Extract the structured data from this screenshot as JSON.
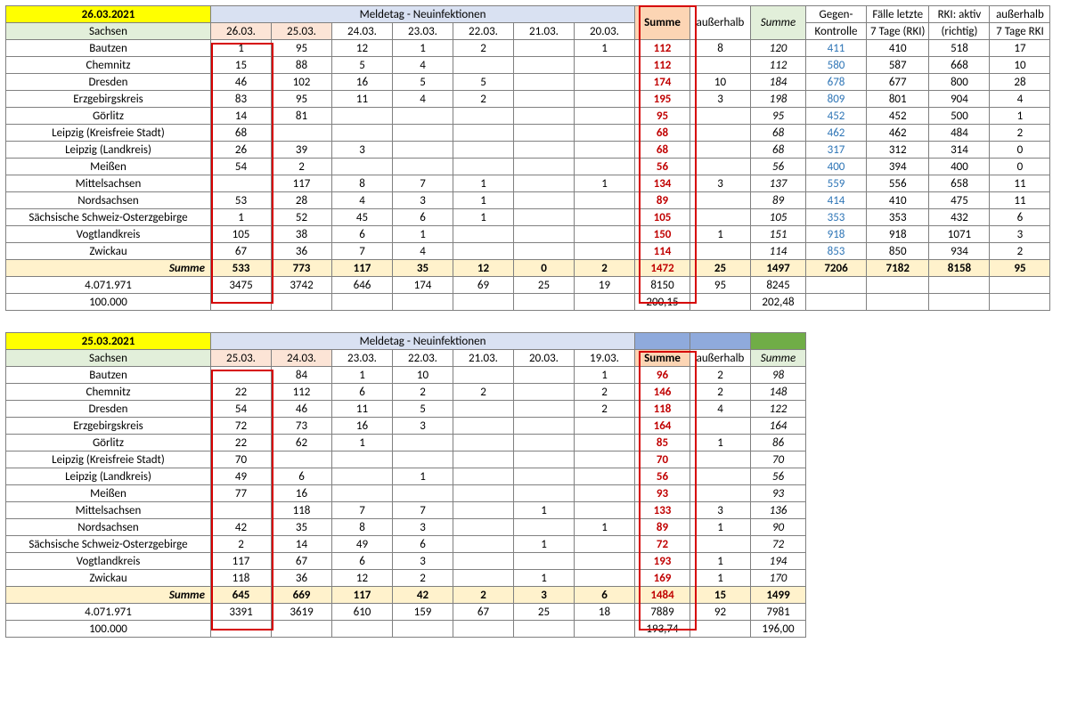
{
  "tables": [
    {
      "date": "26.03.2021",
      "title": "Meldetag - Neuinfektionen",
      "region_header": "Sachsen",
      "dates": [
        "26.03.",
        "25.03.",
        "24.03.",
        "23.03.",
        "22.03.",
        "21.03.",
        "20.03."
      ],
      "sum_label": "Summe",
      "ausserhalb_label": "außerhalb",
      "summe2_label": "Summe",
      "extra_headers1": [
        "Gegen-",
        "Fälle letzte",
        "RKI: aktiv",
        "außerhalb"
      ],
      "extra_headers2": [
        "Kontrolle",
        "7 Tage (RKI)",
        "(richtig)",
        "7 Tage RKI"
      ],
      "rows": [
        {
          "name": "Bautzen",
          "v": [
            "1",
            "95",
            "12",
            "1",
            "2",
            "",
            "1"
          ],
          "sum": "112",
          "aus": "8",
          "sum2": "120",
          "ext": [
            "411",
            "410",
            "518",
            "17"
          ]
        },
        {
          "name": "Chemnitz",
          "v": [
            "15",
            "88",
            "5",
            "4",
            "",
            "",
            ""
          ],
          "sum": "112",
          "aus": "",
          "sum2": "112",
          "ext": [
            "580",
            "587",
            "668",
            "10"
          ]
        },
        {
          "name": "Dresden",
          "v": [
            "46",
            "102",
            "16",
            "5",
            "5",
            "",
            ""
          ],
          "sum": "174",
          "aus": "10",
          "sum2": "184",
          "ext": [
            "678",
            "677",
            "800",
            "28"
          ]
        },
        {
          "name": "Erzgebirgskreis",
          "v": [
            "83",
            "95",
            "11",
            "4",
            "2",
            "",
            ""
          ],
          "sum": "195",
          "aus": "3",
          "sum2": "198",
          "ext": [
            "809",
            "801",
            "904",
            "4"
          ]
        },
        {
          "name": "Görlitz",
          "v": [
            "14",
            "81",
            "",
            "",
            "",
            "",
            ""
          ],
          "sum": "95",
          "aus": "",
          "sum2": "95",
          "ext": [
            "452",
            "452",
            "500",
            "1"
          ]
        },
        {
          "name": "Leipzig (Kreisfreie Stadt)",
          "v": [
            "68",
            "",
            "",
            "",
            "",
            "",
            ""
          ],
          "sum": "68",
          "aus": "",
          "sum2": "68",
          "ext": [
            "462",
            "462",
            "484",
            "2"
          ]
        },
        {
          "name": "Leipzig (Landkreis)",
          "v": [
            "26",
            "39",
            "3",
            "",
            "",
            "",
            ""
          ],
          "sum": "68",
          "aus": "",
          "sum2": "68",
          "ext": [
            "317",
            "312",
            "314",
            "0"
          ]
        },
        {
          "name": "Meißen",
          "v": [
            "54",
            "2",
            "",
            "",
            "",
            "",
            ""
          ],
          "sum": "56",
          "aus": "",
          "sum2": "56",
          "ext": [
            "400",
            "394",
            "400",
            "0"
          ]
        },
        {
          "name": "Mittelsachsen",
          "v": [
            "",
            "117",
            "8",
            "7",
            "1",
            "",
            "1"
          ],
          "sum": "134",
          "aus": "3",
          "sum2": "137",
          "ext": [
            "559",
            "556",
            "658",
            "11"
          ]
        },
        {
          "name": "Nordsachsen",
          "v": [
            "53",
            "28",
            "4",
            "3",
            "1",
            "",
            ""
          ],
          "sum": "89",
          "aus": "",
          "sum2": "89",
          "ext": [
            "414",
            "410",
            "475",
            "11"
          ]
        },
        {
          "name": "Sächsische Schweiz-Osterzgebirge",
          "v": [
            "1",
            "52",
            "45",
            "6",
            "1",
            "",
            ""
          ],
          "sum": "105",
          "aus": "",
          "sum2": "105",
          "ext": [
            "353",
            "353",
            "432",
            "6"
          ]
        },
        {
          "name": "Vogtlandkreis",
          "v": [
            "105",
            "38",
            "6",
            "1",
            "",
            "",
            ""
          ],
          "sum": "150",
          "aus": "1",
          "sum2": "151",
          "ext": [
            "918",
            "918",
            "1071",
            "3"
          ]
        },
        {
          "name": "Zwickau",
          "v": [
            "67",
            "36",
            "7",
            "4",
            "",
            "",
            ""
          ],
          "sum": "114",
          "aus": "",
          "sum2": "114",
          "ext": [
            "853",
            "850",
            "934",
            "2"
          ]
        }
      ],
      "totals": {
        "label": "Summe",
        "v": [
          "533",
          "773",
          "117",
          "35",
          "12",
          "0",
          "2"
        ],
        "sum": "1472",
        "aus": "25",
        "sum2": "1497",
        "ext": [
          "7206",
          "7182",
          "8158",
          "95"
        ]
      },
      "pop": {
        "label": "4.071.971",
        "v": [
          "3475",
          "3742",
          "646",
          "174",
          "69",
          "25",
          "19"
        ],
        "sum": "8150",
        "aus": "95",
        "sum2": "8245"
      },
      "per100k": {
        "label": "100.000",
        "v": [
          "",
          "",
          "",
          "",
          "",
          "",
          ""
        ],
        "sum": "200,15",
        "aus": "",
        "sum2": "202,48"
      }
    },
    {
      "date": "25.03.2021",
      "title": "Meldetag - Neuinfektionen",
      "region_header": "Sachsen",
      "dates": [
        "25.03.",
        "24.03.",
        "23.03.",
        "22.03.",
        "21.03.",
        "20.03.",
        "19.03."
      ],
      "sum_label": "Summe",
      "ausserhalb_label": "außerhalb",
      "summe2_label": "Summe",
      "rows": [
        {
          "name": "Bautzen",
          "v": [
            "",
            "84",
            "1",
            "10",
            "",
            "",
            "1"
          ],
          "sum": "96",
          "aus": "2",
          "sum2": "98"
        },
        {
          "name": "Chemnitz",
          "v": [
            "22",
            "112",
            "6",
            "2",
            "2",
            "",
            "2"
          ],
          "sum": "146",
          "aus": "2",
          "sum2": "148"
        },
        {
          "name": "Dresden",
          "v": [
            "54",
            "46",
            "11",
            "5",
            "",
            "",
            "2"
          ],
          "sum": "118",
          "aus": "4",
          "sum2": "122"
        },
        {
          "name": "Erzgebirgskreis",
          "v": [
            "72",
            "73",
            "16",
            "3",
            "",
            "",
            ""
          ],
          "sum": "164",
          "aus": "",
          "sum2": "164"
        },
        {
          "name": "Görlitz",
          "v": [
            "22",
            "62",
            "1",
            "",
            "",
            "",
            ""
          ],
          "sum": "85",
          "aus": "1",
          "sum2": "86"
        },
        {
          "name": "Leipzig (Kreisfreie Stadt)",
          "v": [
            "70",
            "",
            "",
            "",
            "",
            "",
            ""
          ],
          "sum": "70",
          "aus": "",
          "sum2": "70"
        },
        {
          "name": "Leipzig (Landkreis)",
          "v": [
            "49",
            "6",
            "",
            "1",
            "",
            "",
            ""
          ],
          "sum": "56",
          "aus": "",
          "sum2": "56"
        },
        {
          "name": "Meißen",
          "v": [
            "77",
            "16",
            "",
            "",
            "",
            "",
            ""
          ],
          "sum": "93",
          "aus": "",
          "sum2": "93"
        },
        {
          "name": "Mittelsachsen",
          "v": [
            "",
            "118",
            "7",
            "7",
            "",
            "1",
            ""
          ],
          "sum": "133",
          "aus": "3",
          "sum2": "136"
        },
        {
          "name": "Nordsachsen",
          "v": [
            "42",
            "35",
            "8",
            "3",
            "",
            "",
            "1"
          ],
          "sum": "89",
          "aus": "1",
          "sum2": "90"
        },
        {
          "name": "Sächsische Schweiz-Osterzgebirge",
          "v": [
            "2",
            "14",
            "49",
            "6",
            "",
            "1",
            ""
          ],
          "sum": "72",
          "aus": "",
          "sum2": "72"
        },
        {
          "name": "Vogtlandkreis",
          "v": [
            "117",
            "67",
            "6",
            "3",
            "",
            "",
            ""
          ],
          "sum": "193",
          "aus": "1",
          "sum2": "194"
        },
        {
          "name": "Zwickau",
          "v": [
            "118",
            "36",
            "12",
            "2",
            "",
            "1",
            ""
          ],
          "sum": "169",
          "aus": "1",
          "sum2": "170"
        }
      ],
      "totals": {
        "label": "Summe",
        "v": [
          "645",
          "669",
          "117",
          "42",
          "2",
          "3",
          "6"
        ],
        "sum": "1484",
        "aus": "15",
        "sum2": "1499"
      },
      "pop": {
        "label": "4.071.971",
        "v": [
          "3391",
          "3619",
          "610",
          "159",
          "67",
          "25",
          "18"
        ],
        "sum": "7889",
        "aus": "92",
        "sum2": "7981"
      },
      "per100k": {
        "label": "100.000",
        "v": [
          "",
          "",
          "",
          "",
          "",
          "",
          ""
        ],
        "sum": "193,74",
        "aus": "",
        "sum2": "196,00"
      }
    }
  ]
}
